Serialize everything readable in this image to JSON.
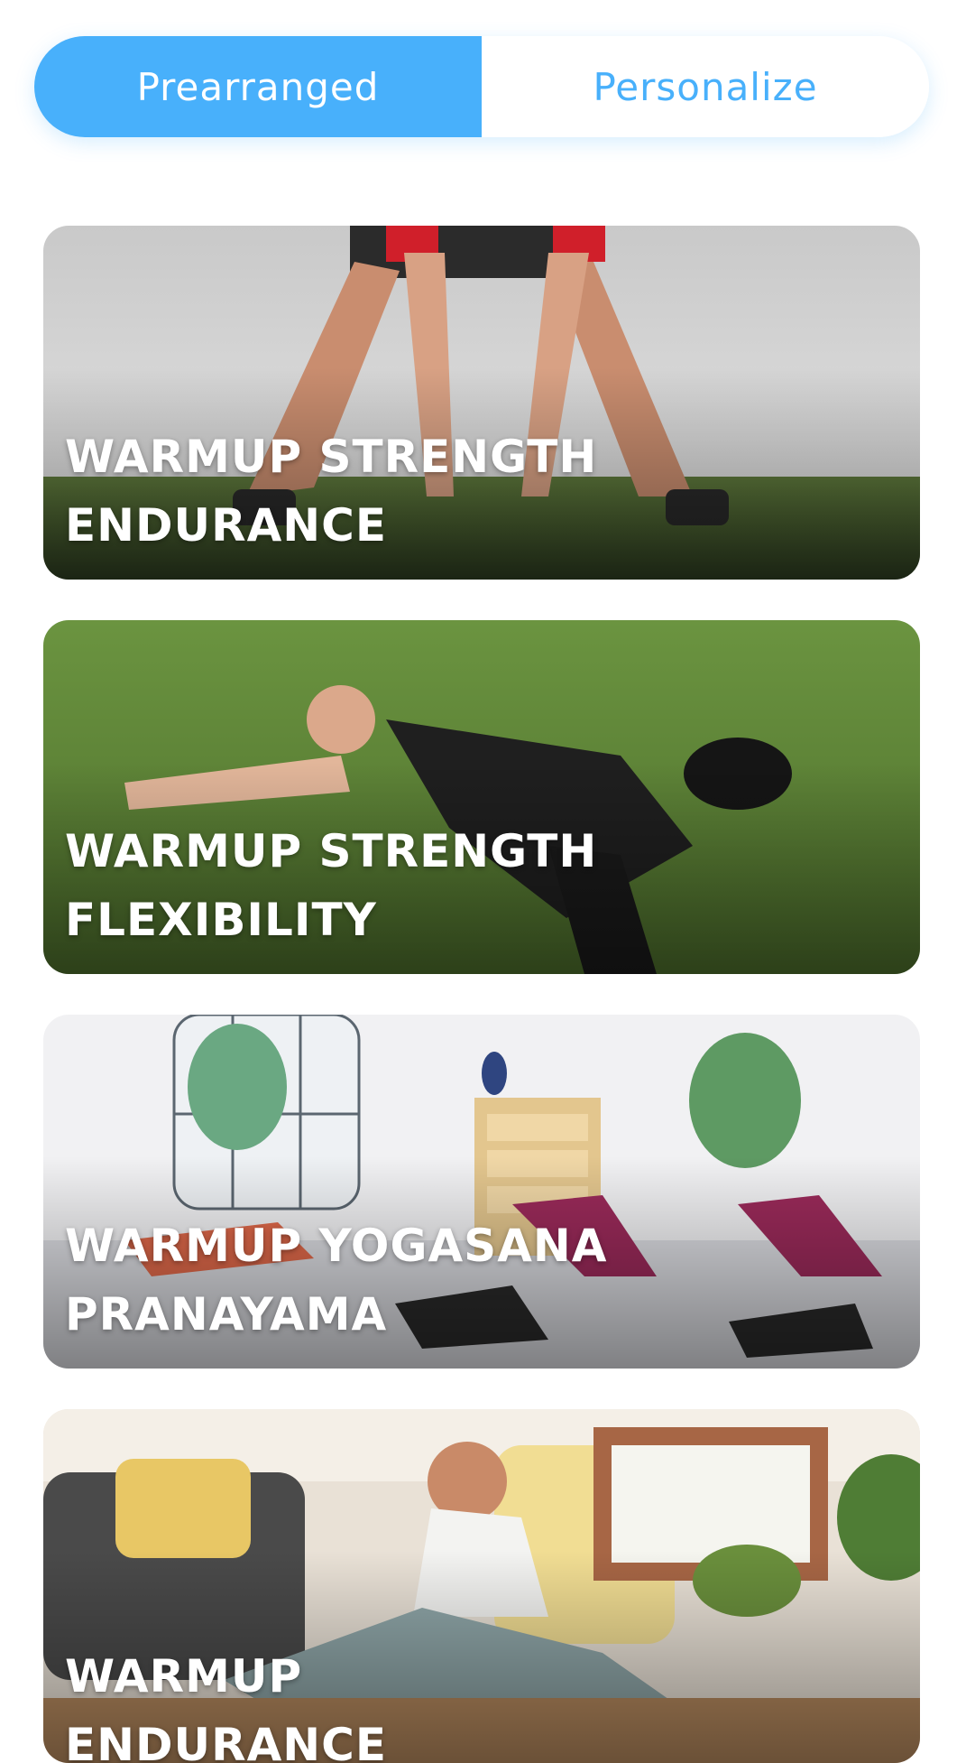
{
  "tabs": {
    "active_label": "Prearranged",
    "inactive_label": "Personalize"
  },
  "workouts": [
    {
      "title": "WARMUP STRENGTH ENDURANCE",
      "image": "man-stretching-on-turf-photo"
    },
    {
      "title": "WARMUP STRENGTH FLEXIBILITY",
      "image": "man-side-stretch-on-grass-photo"
    },
    {
      "title": "WARMUP YOGASANA PRANAYAMA",
      "image": "yoga-class-illustration"
    },
    {
      "title": "WARMUP ENDURANCE FLEXIBILITY",
      "image": "woman-seated-stretch-living-room-photo"
    }
  ],
  "colors": {
    "accent": "#48b0fb",
    "card_text": "#ffffff"
  }
}
